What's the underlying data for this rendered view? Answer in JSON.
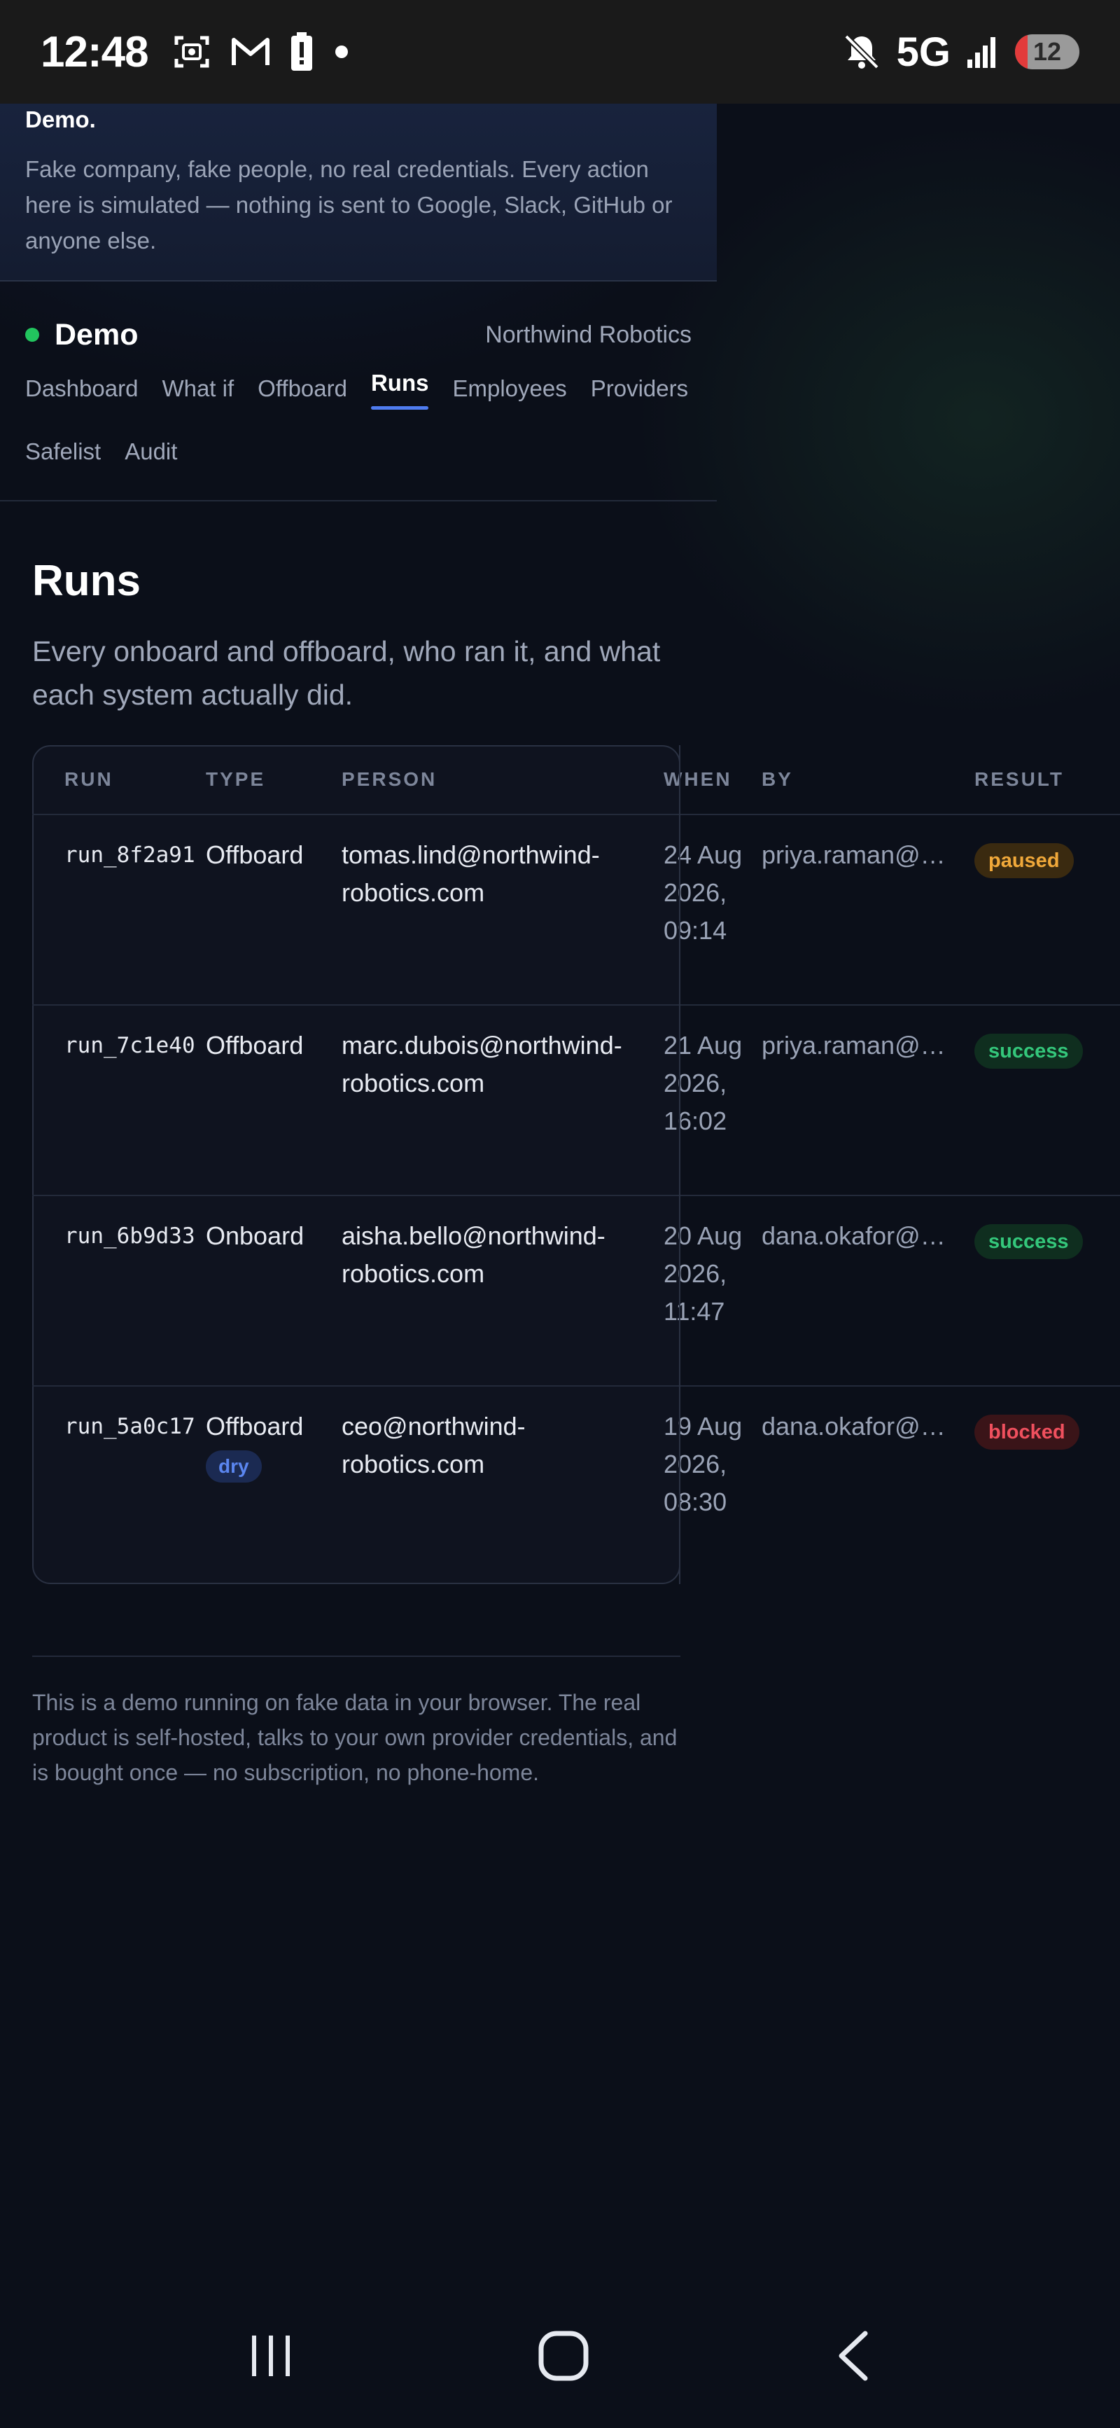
{
  "status_bar": {
    "time": "12:48",
    "network": "5G",
    "battery": "12",
    "icons": [
      "screenshot-icon",
      "gmail-icon",
      "battery-alert-icon",
      "notification-dot-icon",
      "mute-icon",
      "signal-icon"
    ]
  },
  "banner": {
    "title": "Demo.",
    "text": "Fake company, fake people, no real credentials. Every action here is simulated — nothing is sent to Google, Slack, GitHub or anyone else."
  },
  "header": {
    "brand": "Demo",
    "company": "Northwind Robotics",
    "status_color": "#22c55e"
  },
  "tabs": [
    {
      "label": "Dashboard",
      "active": false
    },
    {
      "label": "What if",
      "active": false
    },
    {
      "label": "Offboard",
      "active": false
    },
    {
      "label": "Runs",
      "active": true
    },
    {
      "label": "Employees",
      "active": false
    },
    {
      "label": "Providers",
      "active": false
    },
    {
      "label": "Safelist",
      "active": false
    },
    {
      "label": "Audit",
      "active": false
    }
  ],
  "page": {
    "title": "Runs",
    "subtitle": "Every onboard and offboard, who ran it, and what each system actually did."
  },
  "table": {
    "columns": [
      "RUN",
      "TYPE",
      "PERSON",
      "WHEN",
      "BY",
      "RESULT"
    ],
    "rows": [
      {
        "run": "run_8f2a91",
        "type": "Offboard",
        "dry": "",
        "person": "tomas.lind@northwind-robotics.com",
        "when": "24 Aug 2026, 09:14",
        "by": "priya.raman@…",
        "result": "paused"
      },
      {
        "run": "run_7c1e40",
        "type": "Offboard",
        "dry": "",
        "person": "marc.dubois@northwind-robotics.com",
        "when": "21 Aug 2026, 16:02",
        "by": "priya.raman@…",
        "result": "success"
      },
      {
        "run": "run_6b9d33",
        "type": "Onboard",
        "dry": "",
        "person": "aisha.bello@northwind-robotics.com",
        "when": "20 Aug 2026, 11:47",
        "by": "dana.okafor@…",
        "result": "success"
      },
      {
        "run": "run_5a0c17",
        "type": "Offboard",
        "dry": "dry",
        "person": "ceo@northwind-robotics.com",
        "when": "19 Aug 2026, 08:30",
        "by": "dana.okafor@…",
        "result": "blocked"
      }
    ]
  },
  "footer": {
    "text": "This is a demo running on fake data in your browser. The real product is self-hosted, talks to your own provider credentials, and is bought once — no subscription, no phone-home."
  },
  "nav_bar": {
    "icons": [
      "recent-apps-icon",
      "home-icon",
      "back-icon"
    ]
  }
}
